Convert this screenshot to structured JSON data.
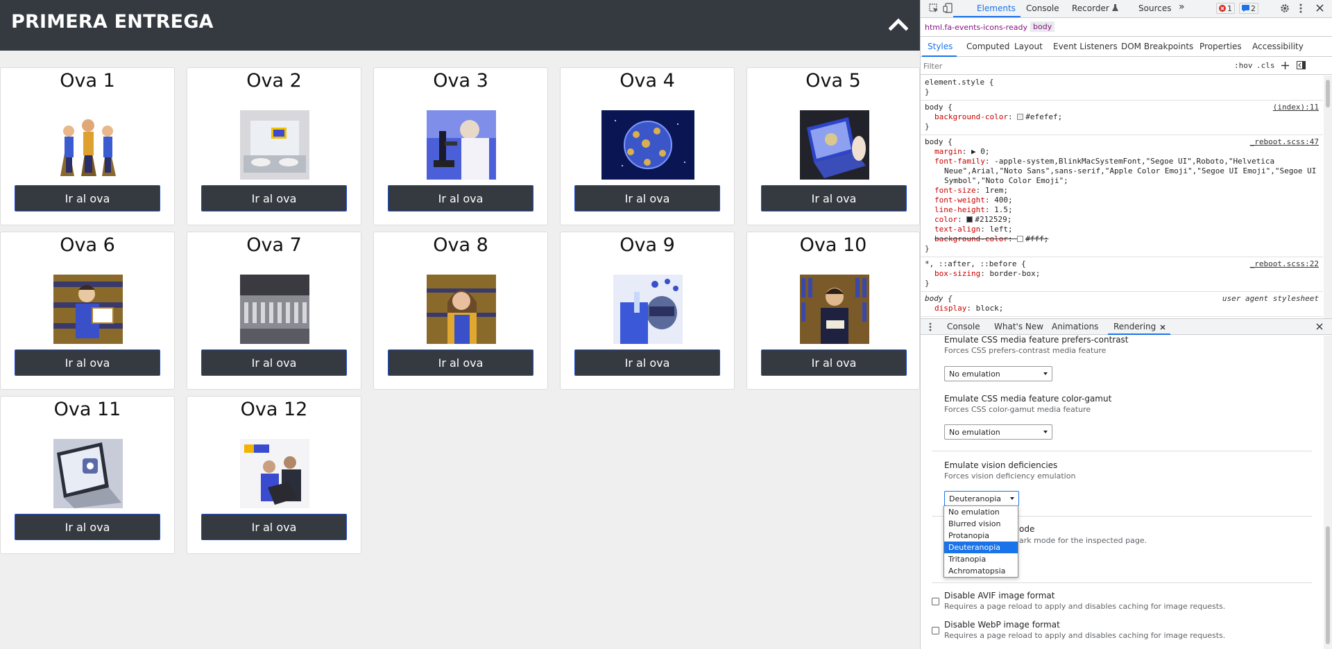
{
  "header": {
    "title": "PRIMERA ENTREGA"
  },
  "cards": [
    {
      "title": "Ova 1",
      "button": "Ir al ova",
      "image": "superheroes-team"
    },
    {
      "title": "Ova 2",
      "button": "Ir al ova",
      "image": "laptop-typing"
    },
    {
      "title": "Ova 3",
      "button": "Ir al ova",
      "image": "microscope-lab"
    },
    {
      "title": "Ova 4",
      "button": "Ir al ova",
      "image": "globe-space"
    },
    {
      "title": "Ova 5",
      "button": "Ir al ova",
      "image": "laptop-hands"
    },
    {
      "title": "Ova 6",
      "button": "Ir al ova",
      "image": "student-diploma"
    },
    {
      "title": "Ova 7",
      "button": "Ir al ova",
      "image": "mixing-console"
    },
    {
      "title": "Ova 8",
      "button": "Ir al ova",
      "image": "cartoon-woman"
    },
    {
      "title": "Ova 9",
      "button": "Ir al ova",
      "image": "lab-scientist"
    },
    {
      "title": "Ova 10",
      "button": "Ir al ova",
      "image": "man-library-book"
    },
    {
      "title": "Ova 11",
      "button": "Ir al ova",
      "image": "laptop-device"
    },
    {
      "title": "Ova 12",
      "button": "Ir al ova",
      "image": "sua-people-laptop"
    }
  ],
  "devtools": {
    "tabs": [
      "Elements",
      "Console",
      "Recorder",
      "Sources"
    ],
    "more": "»",
    "error_count": "1",
    "message_count": "2",
    "breadcrumb": [
      "html.fa-events-icons-ready",
      "body"
    ],
    "style_tabs": [
      "Styles",
      "Computed",
      "Layout",
      "Event Listeners",
      "DOM Breakpoints",
      "Properties",
      "Accessibility"
    ],
    "filter_placeholder": "Filter",
    "hov": ":hov",
    "cls": ".cls",
    "rules": [
      {
        "selector": "element.style {",
        "source": "",
        "lines": [],
        "close": "}"
      },
      {
        "selector": "body {",
        "source": "(index):11",
        "lines": [
          {
            "prop": "background-color",
            "value": "#efefef;",
            "swatch": "#efefef"
          }
        ],
        "close": "}"
      },
      {
        "selector": "body {",
        "source": "_reboot.scss:47",
        "lines": [
          {
            "prop": "margin",
            "value": "▶ 0;"
          },
          {
            "prop": "font-family",
            "value": "-apple-system,BlinkMacSystemFont,\"Segoe UI\",Roboto,\"Helvetica Neue\",Arial,\"Noto Sans\",sans-serif,\"Apple Color Emoji\",\"Segoe UI Emoji\",\"Segoe UI Symbol\",\"Noto Color Emoji\";"
          },
          {
            "prop": "font-size",
            "value": "1rem;"
          },
          {
            "prop": "font-weight",
            "value": "400;"
          },
          {
            "prop": "line-height",
            "value": "1.5;"
          },
          {
            "prop": "color",
            "value": "#212529;",
            "swatch": "#212529"
          },
          {
            "prop": "text-align",
            "value": "left;"
          },
          {
            "prop": "background-color",
            "value": "#fff;",
            "swatch": "#ffffff",
            "strike": true
          }
        ],
        "close": "}"
      },
      {
        "selector": "*, ::after, ::before {",
        "source": "_reboot.scss:22",
        "lines": [
          {
            "prop": "box-sizing",
            "value": "border-box;"
          }
        ],
        "close": "}"
      },
      {
        "selector": "body {",
        "source": "user agent stylesheet",
        "ua": true,
        "lines": [
          {
            "prop": "display",
            "value": "block;"
          }
        ],
        "close": ""
      }
    ],
    "drawer_tabs": [
      "Console",
      "What's New",
      "Animations",
      "Rendering"
    ],
    "rendering": {
      "contrast_title": "Emulate CSS media feature prefers-contrast",
      "contrast_desc": "Forces CSS prefers-contrast media feature",
      "contrast_value": "No emulation",
      "gamut_title": "Emulate CSS media feature color-gamut",
      "gamut_desc": "Forces CSS color-gamut media feature",
      "gamut_value": "No emulation",
      "vision_title": "Emulate vision deficiencies",
      "vision_desc": "Forces vision deficiency emulation",
      "vision_value": "Deuteranopia",
      "vision_options": [
        "No emulation",
        "Blurred vision",
        "Protanopia",
        "Deuteranopia",
        "Tritanopia",
        "Achromatopsia"
      ],
      "vision_selected_index": 3,
      "dark_title_partial": "ode",
      "dark_desc_partial": "ark mode for the inspected page.",
      "avif_title": "Disable AVIF image format",
      "avif_desc": "Requires a page reload to apply and disables caching for image requests.",
      "webp_title": "Disable WebP image format",
      "webp_desc": "Requires a page reload to apply and disables caching for image requests."
    }
  }
}
